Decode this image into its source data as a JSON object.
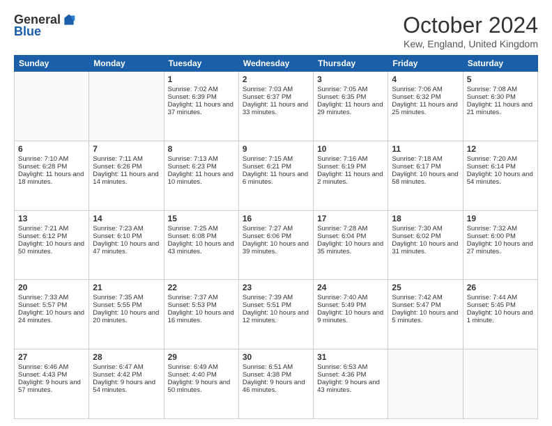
{
  "logo": {
    "general": "General",
    "blue": "Blue"
  },
  "header": {
    "month": "October 2024",
    "location": "Kew, England, United Kingdom"
  },
  "weekdays": [
    "Sunday",
    "Monday",
    "Tuesday",
    "Wednesday",
    "Thursday",
    "Friday",
    "Saturday"
  ],
  "weeks": [
    [
      {
        "day": "",
        "empty": true
      },
      {
        "day": "",
        "empty": true
      },
      {
        "day": "1",
        "sunrise": "Sunrise: 7:02 AM",
        "sunset": "Sunset: 6:39 PM",
        "daylight": "Daylight: 11 hours and 37 minutes."
      },
      {
        "day": "2",
        "sunrise": "Sunrise: 7:03 AM",
        "sunset": "Sunset: 6:37 PM",
        "daylight": "Daylight: 11 hours and 33 minutes."
      },
      {
        "day": "3",
        "sunrise": "Sunrise: 7:05 AM",
        "sunset": "Sunset: 6:35 PM",
        "daylight": "Daylight: 11 hours and 29 minutes."
      },
      {
        "day": "4",
        "sunrise": "Sunrise: 7:06 AM",
        "sunset": "Sunset: 6:32 PM",
        "daylight": "Daylight: 11 hours and 25 minutes."
      },
      {
        "day": "5",
        "sunrise": "Sunrise: 7:08 AM",
        "sunset": "Sunset: 6:30 PM",
        "daylight": "Daylight: 11 hours and 21 minutes."
      }
    ],
    [
      {
        "day": "6",
        "sunrise": "Sunrise: 7:10 AM",
        "sunset": "Sunset: 6:28 PM",
        "daylight": "Daylight: 11 hours and 18 minutes."
      },
      {
        "day": "7",
        "sunrise": "Sunrise: 7:11 AM",
        "sunset": "Sunset: 6:26 PM",
        "daylight": "Daylight: 11 hours and 14 minutes."
      },
      {
        "day": "8",
        "sunrise": "Sunrise: 7:13 AM",
        "sunset": "Sunset: 6:23 PM",
        "daylight": "Daylight: 11 hours and 10 minutes."
      },
      {
        "day": "9",
        "sunrise": "Sunrise: 7:15 AM",
        "sunset": "Sunset: 6:21 PM",
        "daylight": "Daylight: 11 hours and 6 minutes."
      },
      {
        "day": "10",
        "sunrise": "Sunrise: 7:16 AM",
        "sunset": "Sunset: 6:19 PM",
        "daylight": "Daylight: 11 hours and 2 minutes."
      },
      {
        "day": "11",
        "sunrise": "Sunrise: 7:18 AM",
        "sunset": "Sunset: 6:17 PM",
        "daylight": "Daylight: 10 hours and 58 minutes."
      },
      {
        "day": "12",
        "sunrise": "Sunrise: 7:20 AM",
        "sunset": "Sunset: 6:14 PM",
        "daylight": "Daylight: 10 hours and 54 minutes."
      }
    ],
    [
      {
        "day": "13",
        "sunrise": "Sunrise: 7:21 AM",
        "sunset": "Sunset: 6:12 PM",
        "daylight": "Daylight: 10 hours and 50 minutes."
      },
      {
        "day": "14",
        "sunrise": "Sunrise: 7:23 AM",
        "sunset": "Sunset: 6:10 PM",
        "daylight": "Daylight: 10 hours and 47 minutes."
      },
      {
        "day": "15",
        "sunrise": "Sunrise: 7:25 AM",
        "sunset": "Sunset: 6:08 PM",
        "daylight": "Daylight: 10 hours and 43 minutes."
      },
      {
        "day": "16",
        "sunrise": "Sunrise: 7:27 AM",
        "sunset": "Sunset: 6:06 PM",
        "daylight": "Daylight: 10 hours and 39 minutes."
      },
      {
        "day": "17",
        "sunrise": "Sunrise: 7:28 AM",
        "sunset": "Sunset: 6:04 PM",
        "daylight": "Daylight: 10 hours and 35 minutes."
      },
      {
        "day": "18",
        "sunrise": "Sunrise: 7:30 AM",
        "sunset": "Sunset: 6:02 PM",
        "daylight": "Daylight: 10 hours and 31 minutes."
      },
      {
        "day": "19",
        "sunrise": "Sunrise: 7:32 AM",
        "sunset": "Sunset: 6:00 PM",
        "daylight": "Daylight: 10 hours and 27 minutes."
      }
    ],
    [
      {
        "day": "20",
        "sunrise": "Sunrise: 7:33 AM",
        "sunset": "Sunset: 5:57 PM",
        "daylight": "Daylight: 10 hours and 24 minutes."
      },
      {
        "day": "21",
        "sunrise": "Sunrise: 7:35 AM",
        "sunset": "Sunset: 5:55 PM",
        "daylight": "Daylight: 10 hours and 20 minutes."
      },
      {
        "day": "22",
        "sunrise": "Sunrise: 7:37 AM",
        "sunset": "Sunset: 5:53 PM",
        "daylight": "Daylight: 10 hours and 16 minutes."
      },
      {
        "day": "23",
        "sunrise": "Sunrise: 7:39 AM",
        "sunset": "Sunset: 5:51 PM",
        "daylight": "Daylight: 10 hours and 12 minutes."
      },
      {
        "day": "24",
        "sunrise": "Sunrise: 7:40 AM",
        "sunset": "Sunset: 5:49 PM",
        "daylight": "Daylight: 10 hours and 9 minutes."
      },
      {
        "day": "25",
        "sunrise": "Sunrise: 7:42 AM",
        "sunset": "Sunset: 5:47 PM",
        "daylight": "Daylight: 10 hours and 5 minutes."
      },
      {
        "day": "26",
        "sunrise": "Sunrise: 7:44 AM",
        "sunset": "Sunset: 5:45 PM",
        "daylight": "Daylight: 10 hours and 1 minute."
      }
    ],
    [
      {
        "day": "27",
        "sunrise": "Sunrise: 6:46 AM",
        "sunset": "Sunset: 4:43 PM",
        "daylight": "Daylight: 9 hours and 57 minutes."
      },
      {
        "day": "28",
        "sunrise": "Sunrise: 6:47 AM",
        "sunset": "Sunset: 4:42 PM",
        "daylight": "Daylight: 9 hours and 54 minutes."
      },
      {
        "day": "29",
        "sunrise": "Sunrise: 6:49 AM",
        "sunset": "Sunset: 4:40 PM",
        "daylight": "Daylight: 9 hours and 50 minutes."
      },
      {
        "day": "30",
        "sunrise": "Sunrise: 6:51 AM",
        "sunset": "Sunset: 4:38 PM",
        "daylight": "Daylight: 9 hours and 46 minutes."
      },
      {
        "day": "31",
        "sunrise": "Sunrise: 6:53 AM",
        "sunset": "Sunset: 4:36 PM",
        "daylight": "Daylight: 9 hours and 43 minutes."
      },
      {
        "day": "",
        "empty": true
      },
      {
        "day": "",
        "empty": true
      }
    ]
  ]
}
